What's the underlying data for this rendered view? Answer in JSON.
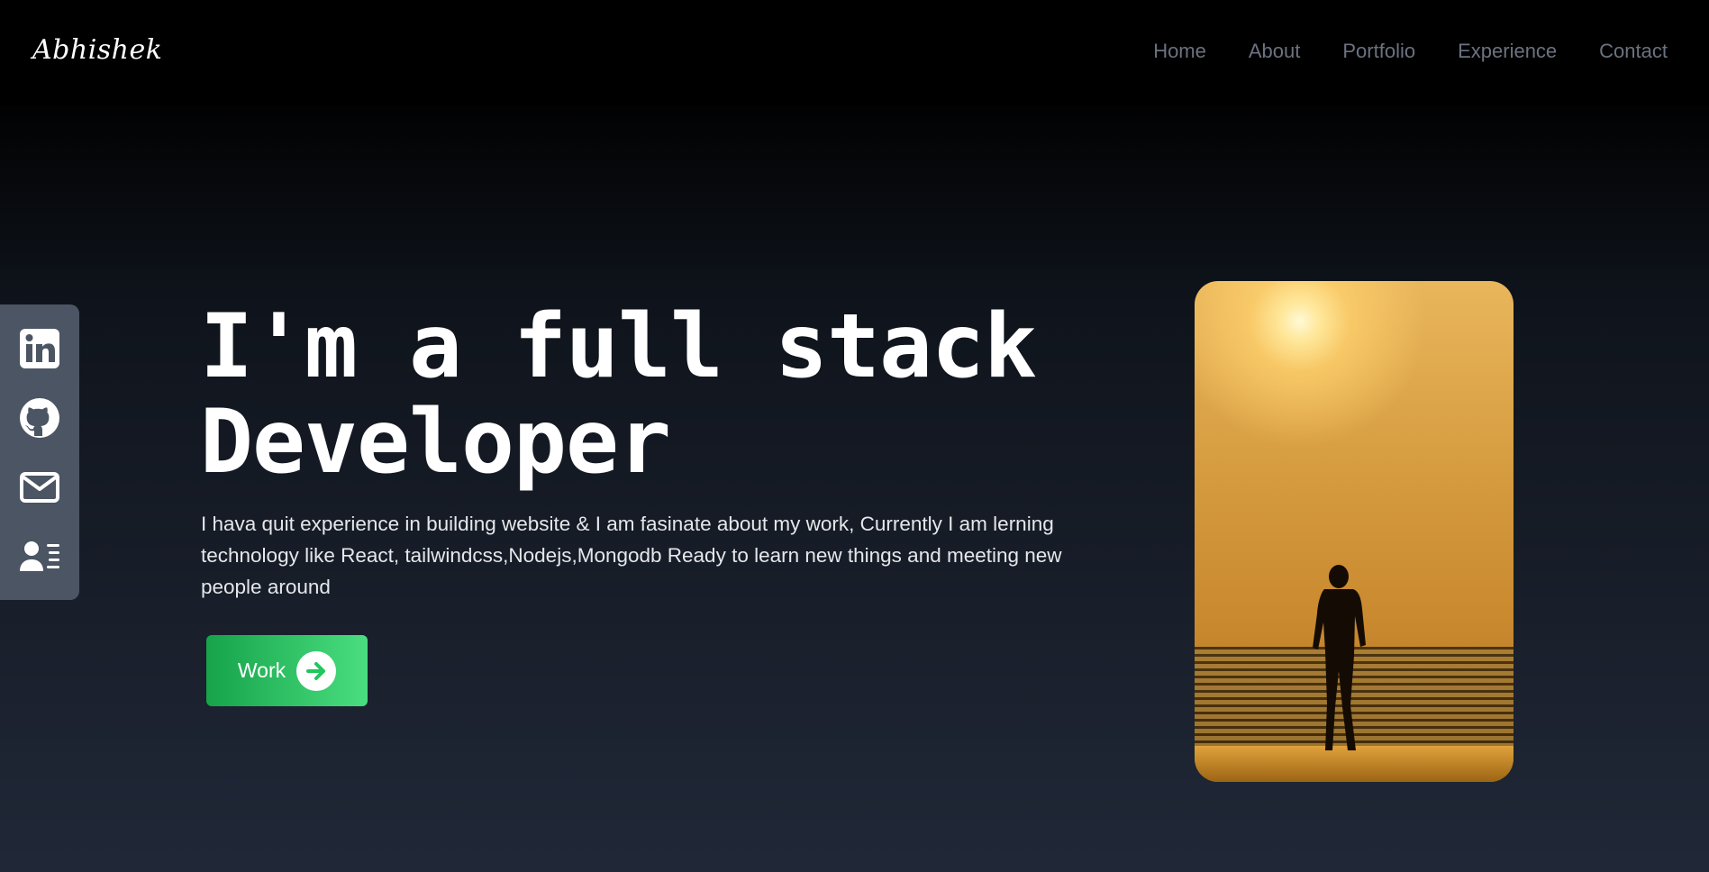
{
  "brand": "Abhishek",
  "nav": {
    "items": [
      {
        "label": "Home"
      },
      {
        "label": "About"
      },
      {
        "label": "Portfolio"
      },
      {
        "label": "Experience"
      },
      {
        "label": "Contact"
      }
    ]
  },
  "social": {
    "icons": [
      "linkedin-icon",
      "github-icon",
      "mail-icon",
      "contact-card-icon"
    ]
  },
  "hero": {
    "headline_line1": "I'm a full stack",
    "headline_line2": "Developer",
    "intro": "I hava quit experience in building website & I am fasinate about my work, Currently I am lerning technology like React, tailwindcss,Nodejs,Mongodb Ready to learn new things and meeting new people around",
    "button_label": "Work"
  },
  "colors": {
    "navbar_bg": "#000000",
    "nav_text": "#6b7280",
    "social_bar": "#4b5563",
    "button_start": "#16a34a",
    "button_end": "#4ade80"
  }
}
